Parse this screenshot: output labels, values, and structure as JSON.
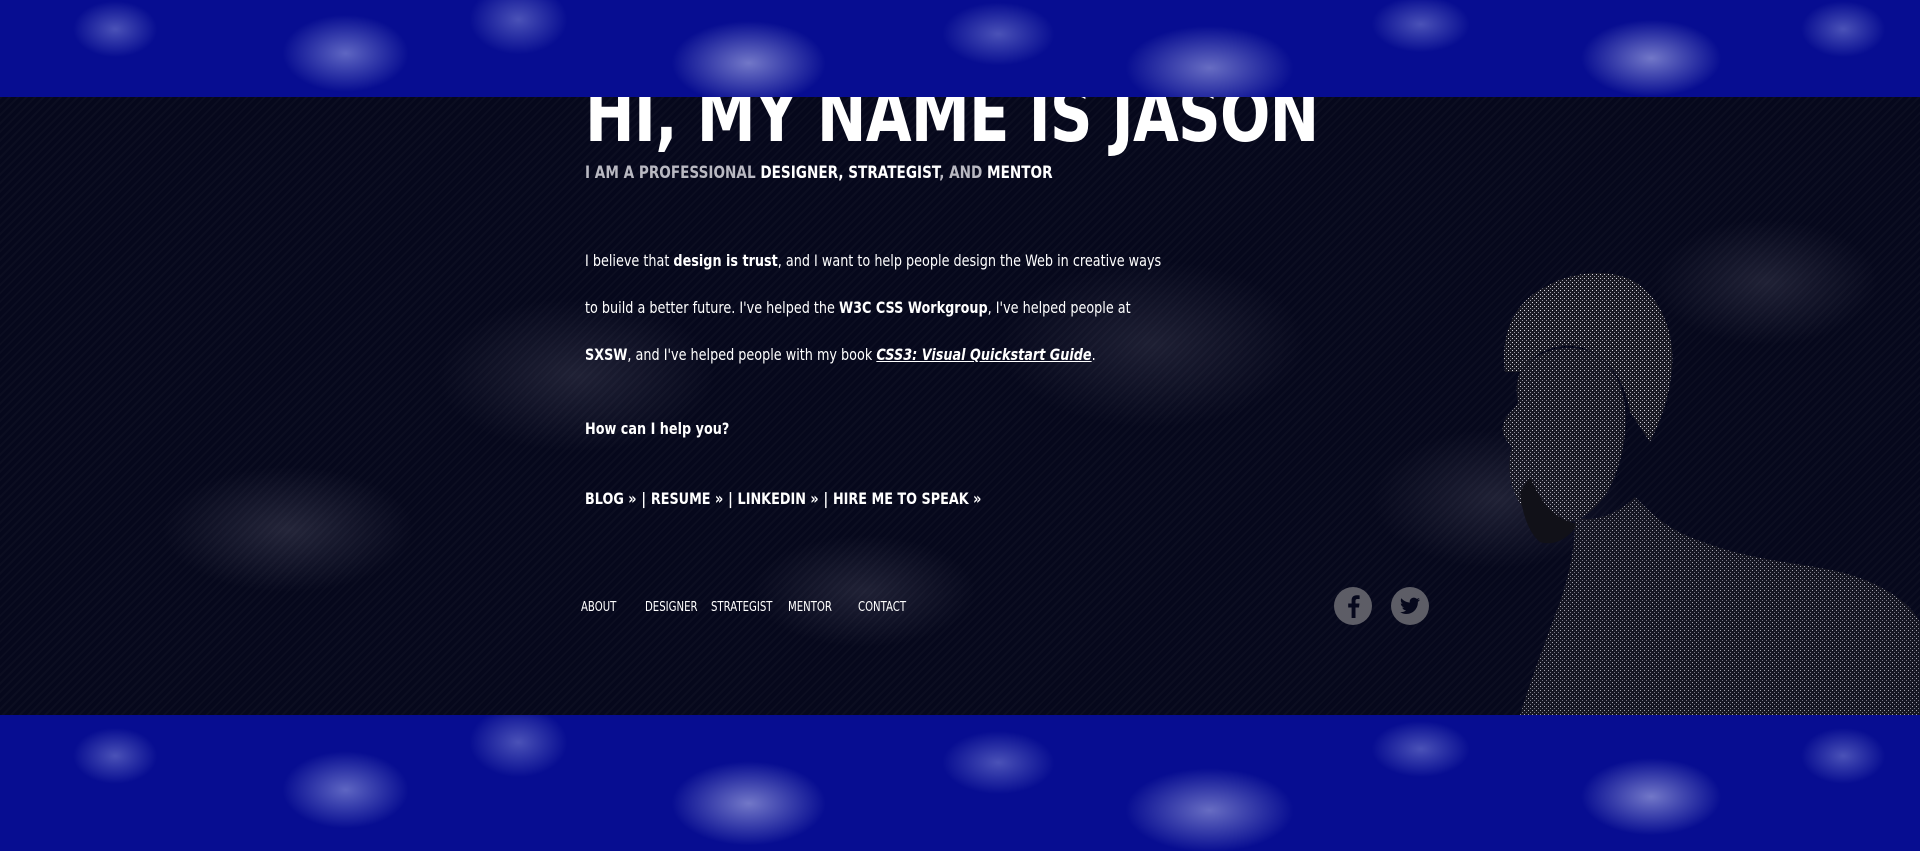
{
  "hero": {
    "headline": "HI, MY NAME IS JASON",
    "tagline": {
      "prefix": "I AM A PROFESSIONAL",
      "role1": "DESIGNER",
      "sep1": ",",
      "role2": "STRATEGIST",
      "sep2": ", AND",
      "role3": "MENTOR"
    }
  },
  "bio": {
    "p1": "I believe that",
    "b1": "design is trust",
    "p2": ", and I want to help people design the Web in creative ways to build a better future. I've helped the",
    "b2": "W3C CSS Workgroup",
    "p3": ", I've helped people at",
    "b3": "SXSW",
    "p4": ", and I've helped people with my book",
    "book": "CSS3: Visual Quickstart Guide",
    "p5": "."
  },
  "help_text": "How can I help you?",
  "links": [
    {
      "label": "BLOG »"
    },
    {
      "label": "RESUME »"
    },
    {
      "label": "LINKEDIN »"
    },
    {
      "label": "HIRE ME TO SPEAK »"
    }
  ],
  "links_separator": "|",
  "nav": [
    {
      "label": "ABOUT"
    },
    {
      "label": "DESIGNER"
    },
    {
      "label": "STRATEGIST"
    },
    {
      "label": "MENTOR"
    },
    {
      "label": "CONTACT"
    }
  ],
  "social": [
    {
      "icon": "facebook-icon"
    },
    {
      "icon": "twitter-icon"
    }
  ],
  "colors": {
    "background_blue": "#070d91",
    "band_dark": "#06081c",
    "text": "#ffffff",
    "muted_text": "#b9b9c2",
    "social_circle": "#5d5d66"
  }
}
